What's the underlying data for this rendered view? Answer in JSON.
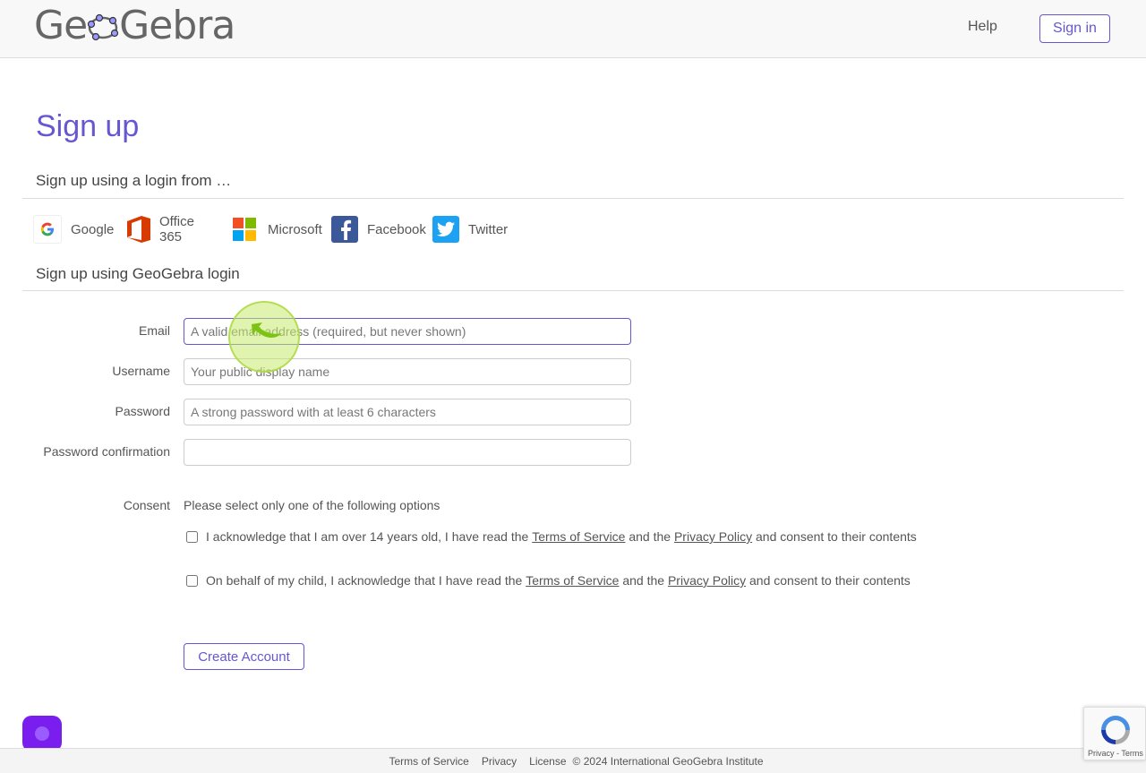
{
  "header": {
    "logo_text_left": "Ge",
    "logo_text_right": "Gebra",
    "help_label": "Help",
    "signin_label": "Sign in"
  },
  "page": {
    "title": "Sign up",
    "social_heading": "Sign up using a login from …",
    "local_heading": "Sign up using GeoGebra login"
  },
  "providers": [
    {
      "label": "Google",
      "icon": "google-icon"
    },
    {
      "label": "Office 365",
      "icon": "office365-icon"
    },
    {
      "label": "Microsoft",
      "icon": "microsoft-icon"
    },
    {
      "label": "Facebook",
      "icon": "facebook-icon"
    },
    {
      "label": "Twitter",
      "icon": "twitter-icon"
    }
  ],
  "form": {
    "email_label": "Email",
    "email_placeholder": "A valid email address (required, but never shown)",
    "email_value": "",
    "username_label": "Username",
    "username_placeholder": "Your public display name",
    "username_value": "",
    "password_label": "Password",
    "password_placeholder": "A strong password with at least 6 characters",
    "password_value": "",
    "confirm_label": "Password confirmation",
    "confirm_placeholder": "",
    "confirm_value": ""
  },
  "consent": {
    "label": "Consent",
    "intro": "Please select only one of the following options",
    "option1_prefix": "I acknowledge that I am over 14 years old, I have read the ",
    "option2_prefix": "On behalf of my child, I acknowledge that I have read the ",
    "terms_link": "Terms of Service",
    "and_the": " and the ",
    "privacy_link": "Privacy Policy",
    "suffix": " and consent to their contents",
    "option1_checked": false,
    "option2_checked": false
  },
  "create_button": "Create Account",
  "footer": {
    "terms": "Terms of Service",
    "privacy": "Privacy",
    "license": "License",
    "copyright": "© 2024 International GeoGebra Institute"
  },
  "recaptcha": {
    "links": "Privacy - Terms"
  },
  "colors": {
    "brand_purple": "#6557d2",
    "chat_purple": "#7a1ef0",
    "facebook_blue": "#3b5998",
    "twitter_blue": "#1da1f2",
    "office_orange": "#d83b01"
  }
}
